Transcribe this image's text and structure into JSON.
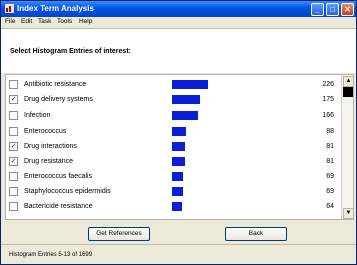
{
  "window": {
    "title": "Index Term Analysis",
    "minimize_glyph": "_",
    "maximize_glyph": "□",
    "close_glyph": "✕"
  },
  "menu": [
    {
      "label": "File"
    },
    {
      "label": "Edit"
    },
    {
      "label": "Task"
    },
    {
      "label": "Tools"
    },
    {
      "label": "Help"
    }
  ],
  "prompt": "Select Histogram Entries of interest:",
  "histogram": {
    "max_count": 226,
    "bar_color": "#0b1fd6",
    "rows": [
      {
        "term": "Antibiotic resistance",
        "count": "226",
        "checked": false
      },
      {
        "term": "Drug delivery systems",
        "count": "175",
        "checked": true
      },
      {
        "term": "Infection",
        "count": "166",
        "checked": false
      },
      {
        "term": "Enterococcus",
        "count": "88",
        "checked": false
      },
      {
        "term": "Drug interactions",
        "count": "81",
        "checked": true
      },
      {
        "term": "Drug resistance",
        "count": "81",
        "checked": true
      },
      {
        "term": "Enterococcus faecalis",
        "count": "69",
        "checked": false
      },
      {
        "term": "Staphylococcus epidermidis",
        "count": "69",
        "checked": false
      },
      {
        "term": "Bactericide resistance",
        "count": "64",
        "checked": false
      }
    ]
  },
  "scroll": {
    "up_glyph": "▲",
    "down_glyph": "▼"
  },
  "buttons": {
    "get_references": "Get References",
    "back": "Back"
  },
  "status": "Histogram Entries 5-13 of 1699"
}
